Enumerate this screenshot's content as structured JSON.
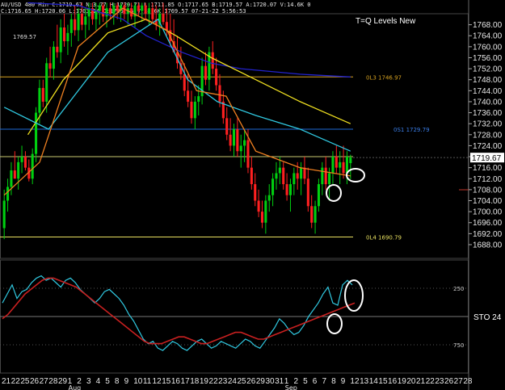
{
  "header": {
    "line1": "AU/USD 480 Min  C:1719.67  N:3.77  H:1720.71  L:1711.85  O:1717.65  B:1719.57  A:1720.07  V:14.6K  0",
    "line2": "C:1716.65 H:1720.06 L:1703.14 O:1706.56 V:28.6K  1769.57  07-21-22 5:56:53"
  },
  "title": "T=Q Levels New",
  "level_labels": [
    "1769.57",
    "0L3 1746.97",
    "0S1 1729.79",
    "0L4 1690.79"
  ],
  "indicator_label": "STO  24",
  "current_price": "1719.67",
  "chart_data": [
    {
      "type": "candlestick",
      "title": "T=Q Levels New",
      "price_scale": [
        "1768.00",
        "1764.00",
        "1760.00",
        "1756.00",
        "1752.00",
        "1748.00",
        "1744.00",
        "1740.00",
        "1736.00",
        "1732.00",
        "1728.00",
        "1724.00",
        "1720.00",
        "1716.00",
        "1712.00",
        "1708.00",
        "1704.00",
        "1700.00",
        "1696.00",
        "1692.00",
        "1688.00"
      ],
      "ylim": [
        1683,
        1772
      ],
      "horizontal_levels": [
        {
          "label": "0L3 1746.97",
          "value": 1749,
          "color": "#d4a020"
        },
        {
          "label": "0S1 1729.79",
          "value": 1730,
          "color": "#1e6ad8"
        },
        {
          "label": "",
          "value": 1720,
          "color": "#c8c870"
        },
        {
          "label": "0L4 1690.79",
          "value": 1690.8,
          "color": "#e8e060"
        }
      ],
      "moving_averages": [
        {
          "color": "#2222cc",
          "points": [
            [
              8,
              1776
            ],
            [
              25,
              1775
            ],
            [
              40,
              1770
            ],
            [
              48,
              1764
            ],
            [
              60,
              1758
            ],
            [
              70,
              1754
            ],
            [
              80,
              1752
            ],
            [
              100,
              1750
            ],
            [
              117,
              1749
            ]
          ]
        },
        {
          "color": "#f0e020",
          "points": [
            [
              8,
              1728
            ],
            [
              20,
              1748
            ],
            [
              35,
              1765
            ],
            [
              48,
              1770
            ],
            [
              58,
              1764
            ],
            [
              70,
              1756
            ],
            [
              85,
              1748
            ],
            [
              100,
              1740
            ],
            [
              117,
              1732
            ]
          ]
        },
        {
          "color": "#30c8e0",
          "points": [
            [
              0,
              1738
            ],
            [
              15,
              1730
            ],
            [
              35,
              1758
            ],
            [
              52,
              1770
            ],
            [
              62,
              1748
            ],
            [
              72,
              1740
            ],
            [
              85,
              1735
            ],
            [
              100,
              1730
            ],
            [
              117,
              1722
            ]
          ]
        },
        {
          "color": "#f08020",
          "points": [
            [
              0,
              1706
            ],
            [
              12,
              1718
            ],
            [
              25,
              1760
            ],
            [
              40,
              1774
            ],
            [
              55,
              1766
            ],
            [
              65,
              1744
            ],
            [
              75,
              1742
            ],
            [
              85,
              1722
            ],
            [
              100,
              1716
            ],
            [
              117,
              1713
            ]
          ]
        }
      ],
      "ohlc": [
        [
          1694,
          1708,
          1690,
          1704
        ],
        [
          1704,
          1712,
          1700,
          1709
        ],
        [
          1709,
          1718,
          1706,
          1715
        ],
        [
          1715,
          1722,
          1712,
          1712
        ],
        [
          1712,
          1720,
          1708,
          1718
        ],
        [
          1718,
          1724,
          1714,
          1720
        ],
        [
          1720,
          1722,
          1715,
          1716
        ],
        [
          1716,
          1719,
          1711,
          1712
        ],
        [
          1712,
          1723,
          1710,
          1721
        ],
        [
          1721,
          1738,
          1718,
          1736
        ],
        [
          1736,
          1748,
          1732,
          1745
        ],
        [
          1745,
          1748,
          1738,
          1740
        ],
        [
          1740,
          1756,
          1736,
          1754
        ],
        [
          1754,
          1760,
          1749,
          1752
        ],
        [
          1752,
          1762,
          1748,
          1760
        ],
        [
          1760,
          1768,
          1756,
          1758
        ],
        [
          1758,
          1770,
          1754,
          1767
        ],
        [
          1767,
          1772,
          1760,
          1762
        ],
        [
          1762,
          1768,
          1757,
          1765
        ],
        [
          1765,
          1772,
          1760,
          1770
        ],
        [
          1770,
          1775,
          1764,
          1766
        ],
        [
          1766,
          1774,
          1762,
          1772
        ],
        [
          1772,
          1776,
          1766,
          1768
        ],
        [
          1768,
          1774,
          1763,
          1771
        ],
        [
          1771,
          1776,
          1766,
          1774
        ],
        [
          1774,
          1776,
          1768,
          1770
        ],
        [
          1770,
          1776,
          1766,
          1773
        ],
        [
          1773,
          1776,
          1768,
          1775
        ],
        [
          1775,
          1776,
          1769,
          1771
        ],
        [
          1771,
          1776,
          1767,
          1774
        ],
        [
          1774,
          1776,
          1770,
          1772
        ],
        [
          1772,
          1776,
          1768,
          1775
        ],
        [
          1775,
          1776,
          1770,
          1773
        ],
        [
          1773,
          1776,
          1769,
          1775
        ],
        [
          1775,
          1776,
          1770,
          1772
        ],
        [
          1772,
          1776,
          1768,
          1774
        ],
        [
          1774,
          1776,
          1770,
          1771
        ],
        [
          1771,
          1776,
          1767,
          1775
        ],
        [
          1775,
          1776,
          1771,
          1773
        ],
        [
          1773,
          1776,
          1769,
          1775
        ],
        [
          1775,
          1776,
          1770,
          1772
        ],
        [
          1772,
          1776,
          1768,
          1774
        ],
        [
          1774,
          1776,
          1769,
          1770
        ],
        [
          1770,
          1775,
          1766,
          1768
        ],
        [
          1768,
          1774,
          1764,
          1772
        ],
        [
          1772,
          1776,
          1768,
          1769
        ],
        [
          1769,
          1774,
          1764,
          1766
        ],
        [
          1766,
          1772,
          1760,
          1762
        ],
        [
          1762,
          1770,
          1758,
          1758
        ],
        [
          1758,
          1764,
          1752,
          1754
        ],
        [
          1754,
          1760,
          1748,
          1750
        ],
        [
          1750,
          1754,
          1742,
          1744
        ],
        [
          1744,
          1750,
          1738,
          1740
        ],
        [
          1740,
          1744,
          1732,
          1734
        ],
        [
          1734,
          1742,
          1730,
          1740
        ],
        [
          1740,
          1746,
          1735,
          1742
        ],
        [
          1742,
          1756,
          1739,
          1753
        ],
        [
          1753,
          1758,
          1746,
          1748
        ],
        [
          1748,
          1760,
          1744,
          1758
        ],
        [
          1758,
          1762,
          1750,
          1752
        ],
        [
          1752,
          1756,
          1744,
          1746
        ],
        [
          1746,
          1750,
          1738,
          1740
        ],
        [
          1740,
          1744,
          1732,
          1734
        ],
        [
          1734,
          1738,
          1726,
          1728
        ],
        [
          1728,
          1734,
          1722,
          1724
        ],
        [
          1724,
          1732,
          1720,
          1730
        ],
        [
          1730,
          1734,
          1720,
          1722
        ],
        [
          1722,
          1728,
          1716,
          1724
        ],
        [
          1724,
          1730,
          1718,
          1726
        ],
        [
          1726,
          1730,
          1714,
          1716
        ],
        [
          1716,
          1720,
          1708,
          1710
        ],
        [
          1710,
          1714,
          1702,
          1704
        ],
        [
          1704,
          1708,
          1698,
          1700
        ],
        [
          1700,
          1704,
          1694,
          1696
        ],
        [
          1696,
          1706,
          1692,
          1704
        ],
        [
          1704,
          1710,
          1700,
          1706
        ],
        [
          1706,
          1714,
          1702,
          1712
        ],
        [
          1712,
          1718,
          1708,
          1714
        ],
        [
          1714,
          1720,
          1710,
          1716
        ],
        [
          1716,
          1718,
          1708,
          1710
        ],
        [
          1710,
          1714,
          1704,
          1706
        ],
        [
          1706,
          1712,
          1700,
          1710
        ],
        [
          1710,
          1716,
          1706,
          1714
        ],
        [
          1714,
          1718,
          1708,
          1712
        ],
        [
          1712,
          1718,
          1706,
          1716
        ],
        [
          1716,
          1720,
          1710,
          1712
        ],
        [
          1712,
          1716,
          1700,
          1702
        ],
        [
          1702,
          1706,
          1694,
          1696
        ],
        [
          1696,
          1704,
          1692,
          1702
        ],
        [
          1702,
          1712,
          1700,
          1710
        ],
        [
          1710,
          1718,
          1706,
          1716
        ],
        [
          1716,
          1720,
          1708,
          1710
        ],
        [
          1710,
          1716,
          1704,
          1714
        ],
        [
          1714,
          1722,
          1710,
          1720
        ],
        [
          1720,
          1724,
          1714,
          1716
        ],
        [
          1716,
          1722,
          1710,
          1718
        ],
        [
          1718,
          1724,
          1712,
          1714
        ],
        [
          1714,
          1722,
          1710,
          1720
        ],
        [
          1717.65,
          1720.71,
          1711.85,
          1719.67
        ]
      ]
    },
    {
      "type": "line",
      "title": "STO 24",
      "ylim": [
        0,
        100
      ],
      "scale_labels": [
        "250",
        "750"
      ],
      "series": [
        {
          "color": "#30c8e0",
          "values": [
            62,
            70,
            78,
            66,
            72,
            74,
            80,
            84,
            86,
            82,
            84,
            80,
            76,
            82,
            84,
            80,
            74,
            70,
            66,
            62,
            66,
            72,
            74,
            70,
            66,
            60,
            52,
            46,
            38,
            30,
            26,
            28,
            22,
            20,
            24,
            28,
            26,
            22,
            20,
            24,
            28,
            30,
            26,
            22,
            24,
            28,
            26,
            24,
            22,
            26,
            30,
            28,
            24,
            22,
            28,
            34,
            40,
            48,
            44,
            38,
            34,
            36,
            42,
            50,
            56,
            62,
            70,
            76,
            62,
            60,
            78,
            82,
            78
          ]
        },
        {
          "color": "#c82020",
          "values": [
            48,
            52,
            58,
            64,
            70,
            74,
            78,
            82,
            84,
            84,
            82,
            80,
            78,
            76,
            72,
            68,
            64,
            60,
            56,
            52,
            48,
            44,
            40,
            36,
            32,
            28,
            26,
            26,
            26,
            28,
            30,
            32,
            32,
            30,
            28,
            26,
            26,
            28,
            30,
            32,
            34,
            36,
            36,
            34,
            32,
            30,
            30,
            32,
            34,
            36,
            38,
            40,
            42,
            44,
            46,
            48,
            50,
            52,
            54,
            56,
            58,
            60,
            62
          ]
        }
      ],
      "circled_points_note": ""
    }
  ],
  "x_axis": {
    "day_labels": [
      "21",
      "22",
      "25",
      "26",
      "27",
      "28",
      "29",
      "1",
      "2",
      "3",
      "4",
      "5",
      "8",
      "9",
      "10",
      "11",
      "12",
      "15",
      "16",
      "17",
      "18",
      "19",
      "22",
      "23",
      "24",
      "25",
      "26",
      "29",
      "30",
      "31",
      "1",
      "2",
      "5",
      "6",
      "7",
      "8",
      "9",
      "12",
      "13",
      "14",
      "15",
      "16",
      "19",
      "20",
      "21",
      "22",
      "23",
      "26",
      "27",
      "28"
    ],
    "month_labels": [
      {
        "label": "Aug",
        "day_index": 7
      },
      {
        "label": "Sep",
        "day_index": 30
      }
    ]
  },
  "colors": {
    "up_candle": "#00d010",
    "down_candle": "#ff2020",
    "grid": "#1a1a1a",
    "panel_border": "#444444",
    "text": "#e8e8e8",
    "annotation": "#ffffff"
  }
}
